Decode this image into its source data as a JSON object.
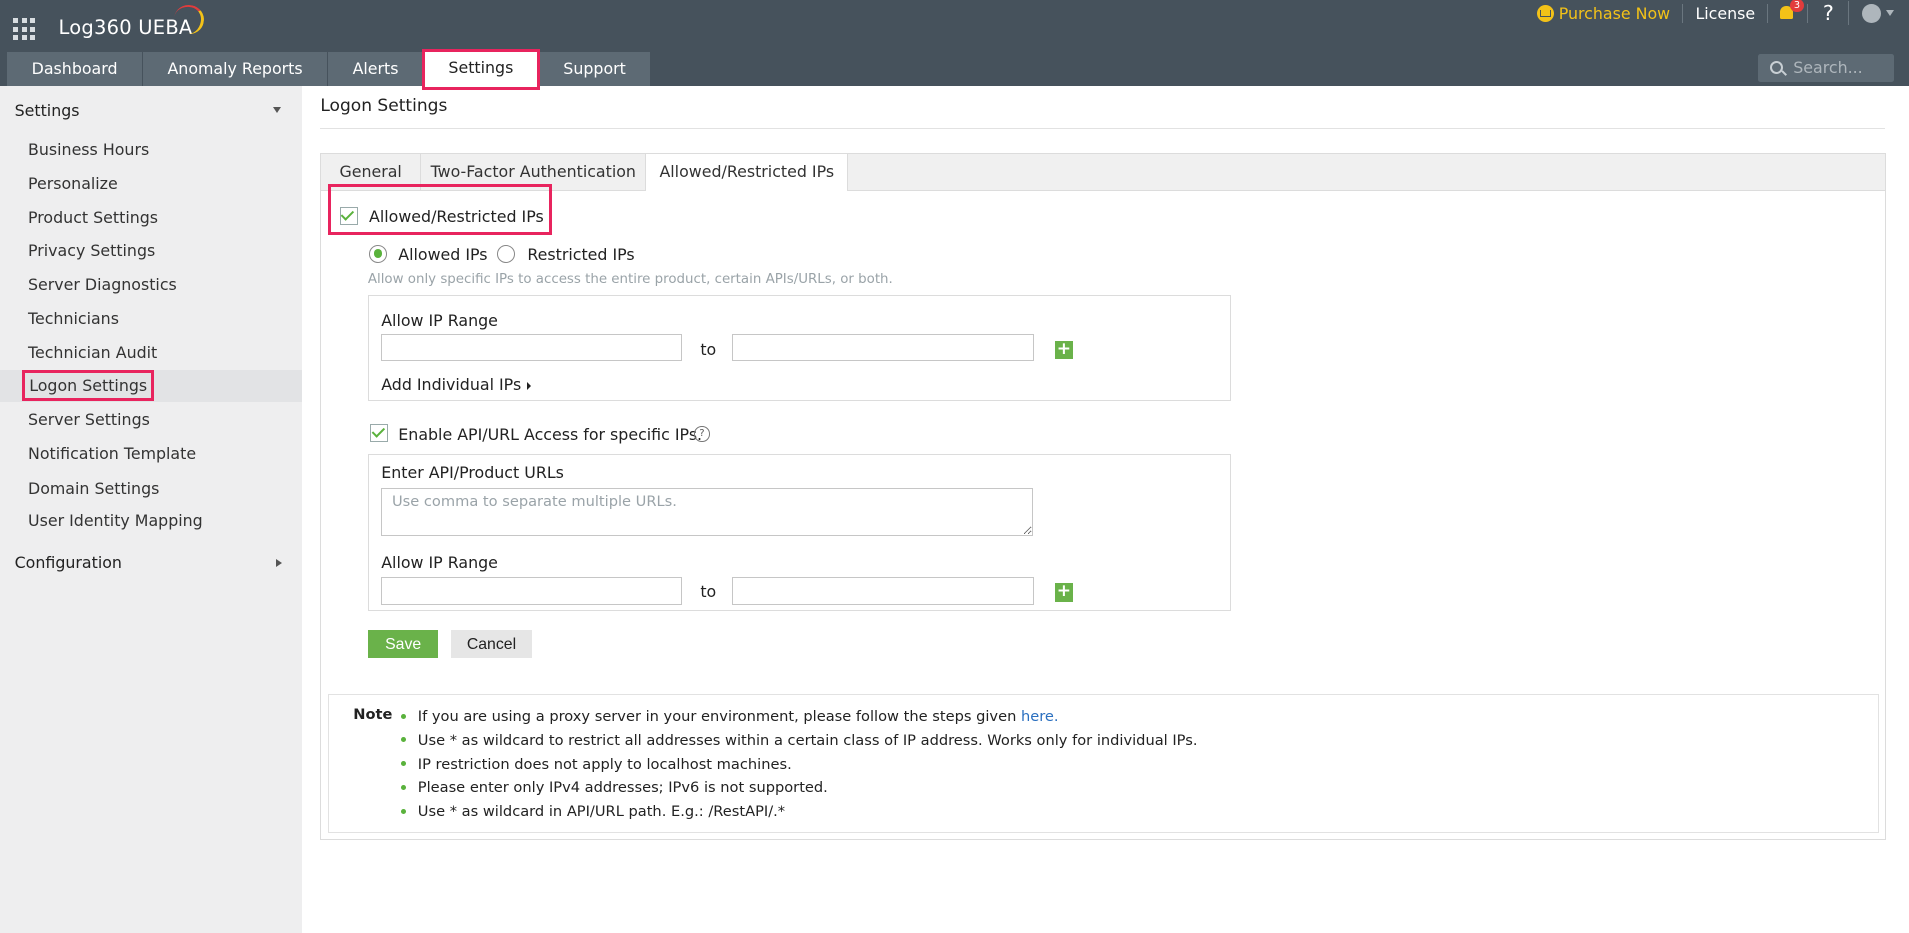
{
  "app": {
    "title": "Log360 UEBA"
  },
  "header": {
    "purchase": "Purchase Now",
    "license": "License",
    "notification_count": "3",
    "help": "?",
    "search_placeholder": "Search..."
  },
  "tabs": [
    "Dashboard",
    "Anomaly Reports",
    "Alerts",
    "Settings",
    "Support"
  ],
  "sidebar": {
    "settings_heading": "Settings",
    "items": [
      "Business Hours",
      "Personalize",
      "Product Settings",
      "Privacy Settings",
      "Server Diagnostics",
      "Technicians",
      "Technician Audit",
      "Logon Settings",
      "Server Settings",
      "Notification Template",
      "Domain Settings",
      "User Identity Mapping"
    ],
    "configuration_heading": "Configuration"
  },
  "main": {
    "page_title": "Logon Settings",
    "tabs": [
      "General",
      "Two-Factor Authentication",
      "Allowed/Restricted IPs"
    ],
    "enable_label": "Allowed/Restricted IPs",
    "radio_allowed": "Allowed IPs",
    "radio_restricted": "Restricted IPs",
    "hint": "Allow only specific IPs to access the entire product, certain APIs/URLs, or both.",
    "allow_ip_range": "Allow IP Range",
    "to": "to",
    "add_individual": "Add Individual IPs",
    "api_label": "Enable API/URL Access for specific IPs.",
    "api_urls_label": "Enter API/Product URLs",
    "api_urls_placeholder": "Use comma to separate multiple URLs.",
    "save": "Save",
    "cancel": "Cancel"
  },
  "note": {
    "title": "Note",
    "items": [
      "If you are using a proxy server in your environment, please follow the steps given ",
      "Use * as wildcard to restrict all addresses within a certain class of IP address. Works only for individual IPs.",
      "IP restriction does not apply to localhost machines.",
      "Please enter only IPv4 addresses; IPv6 is not supported.",
      "Use * as wildcard in API/URL path. E.g.: /RestAPI/.*"
    ],
    "link_text": "here."
  },
  "colors": {
    "accent_green": "#6ab24a",
    "highlight": "#e8245e",
    "topbar": "#46525c",
    "purchase": "#f3c218"
  }
}
